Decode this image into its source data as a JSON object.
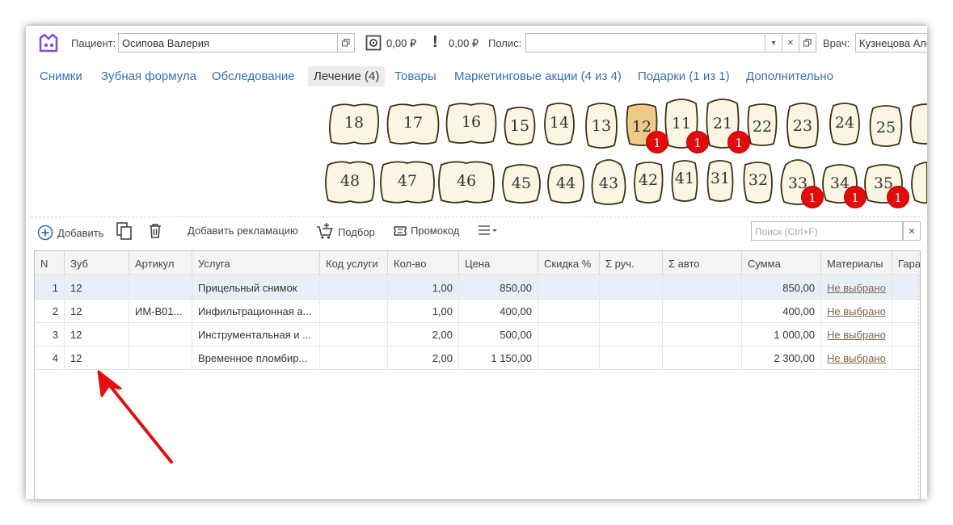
{
  "header": {
    "patient_label": "Пациент:",
    "patient_value": "Осипова Валерия",
    "balance1": "0,00 ₽",
    "balance2": "0,00 ₽",
    "policy_label": "Полис:",
    "policy_value": "",
    "doctor_label": "Врач:",
    "doctor_value": "Кузнецова Але"
  },
  "tabs": [
    {
      "label": "Снимки"
    },
    {
      "label": "Зубная формула"
    },
    {
      "label": "Обследование"
    },
    {
      "label": "Лечение (4)"
    },
    {
      "label": "Товары"
    },
    {
      "label": "Маркетинговые акции (4 из 4)"
    },
    {
      "label": "Подарки (1 из 1)"
    },
    {
      "label": "Дополнительно"
    }
  ],
  "teeth_upper": [
    "18",
    "17",
    "16",
    "15",
    "14",
    "13",
    "12",
    "11",
    "21",
    "22",
    "23",
    "24",
    "25",
    "2"
  ],
  "teeth_lower": [
    "48",
    "47",
    "46",
    "45",
    "44",
    "43",
    "42",
    "41",
    "31",
    "32",
    "33",
    "34",
    "35",
    ""
  ],
  "badges": [
    "1",
    "1",
    "1",
    "1",
    "1",
    "1"
  ],
  "toolbar": {
    "add": "Добавить",
    "complaint": "Добавить рекламацию",
    "selection": "Подбор",
    "promo": "Промокод",
    "search_placeholder": "Поиск (Ctrl+F)"
  },
  "table": {
    "columns": [
      "N",
      "Зуб",
      "Артикул",
      "Услуга",
      "Код услуги",
      "Кол-во",
      "Цена",
      "Скидка %",
      "Σ руч.",
      "Σ авто",
      "Сумма",
      "Материалы",
      "Гара"
    ],
    "rows": [
      {
        "n": "1",
        "tooth": "12",
        "article": "",
        "service": "Прицельный снимок",
        "code": "",
        "qty": "1,00",
        "price": "850,00",
        "discount": "",
        "sum_manual": "",
        "sum_auto": "",
        "sum": "850,00",
        "materials": "Не выбрано"
      },
      {
        "n": "2",
        "tooth": "12",
        "article": "ИМ-В01...",
        "service": "Инфильтрационная а...",
        "code": "",
        "qty": "1,00",
        "price": "400,00",
        "discount": "",
        "sum_manual": "",
        "sum_auto": "",
        "sum": "400,00",
        "materials": "Не выбрано"
      },
      {
        "n": "3",
        "tooth": "12",
        "article": "",
        "service": "Инструментальная и ...",
        "code": "",
        "qty": "2,00",
        "price": "500,00",
        "discount": "",
        "sum_manual": "",
        "sum_auto": "",
        "sum": "1 000,00",
        "materials": "Не выбрано"
      },
      {
        "n": "4",
        "tooth": "12",
        "article": "",
        "service": "Временное пломбир...",
        "code": "",
        "qty": "2,00",
        "price": "1 150,00",
        "discount": "",
        "sum_manual": "",
        "sum_auto": "",
        "sum": "2 300,00",
        "materials": "Не выбрано"
      }
    ]
  },
  "colors": {
    "accent": "#3a6fb0",
    "tooth_fill": "#fbf6e3",
    "tooth_selected": "#edca8a",
    "badge": "#e10b0b",
    "arrow": "#e21010",
    "logo": "#7b4be0"
  }
}
